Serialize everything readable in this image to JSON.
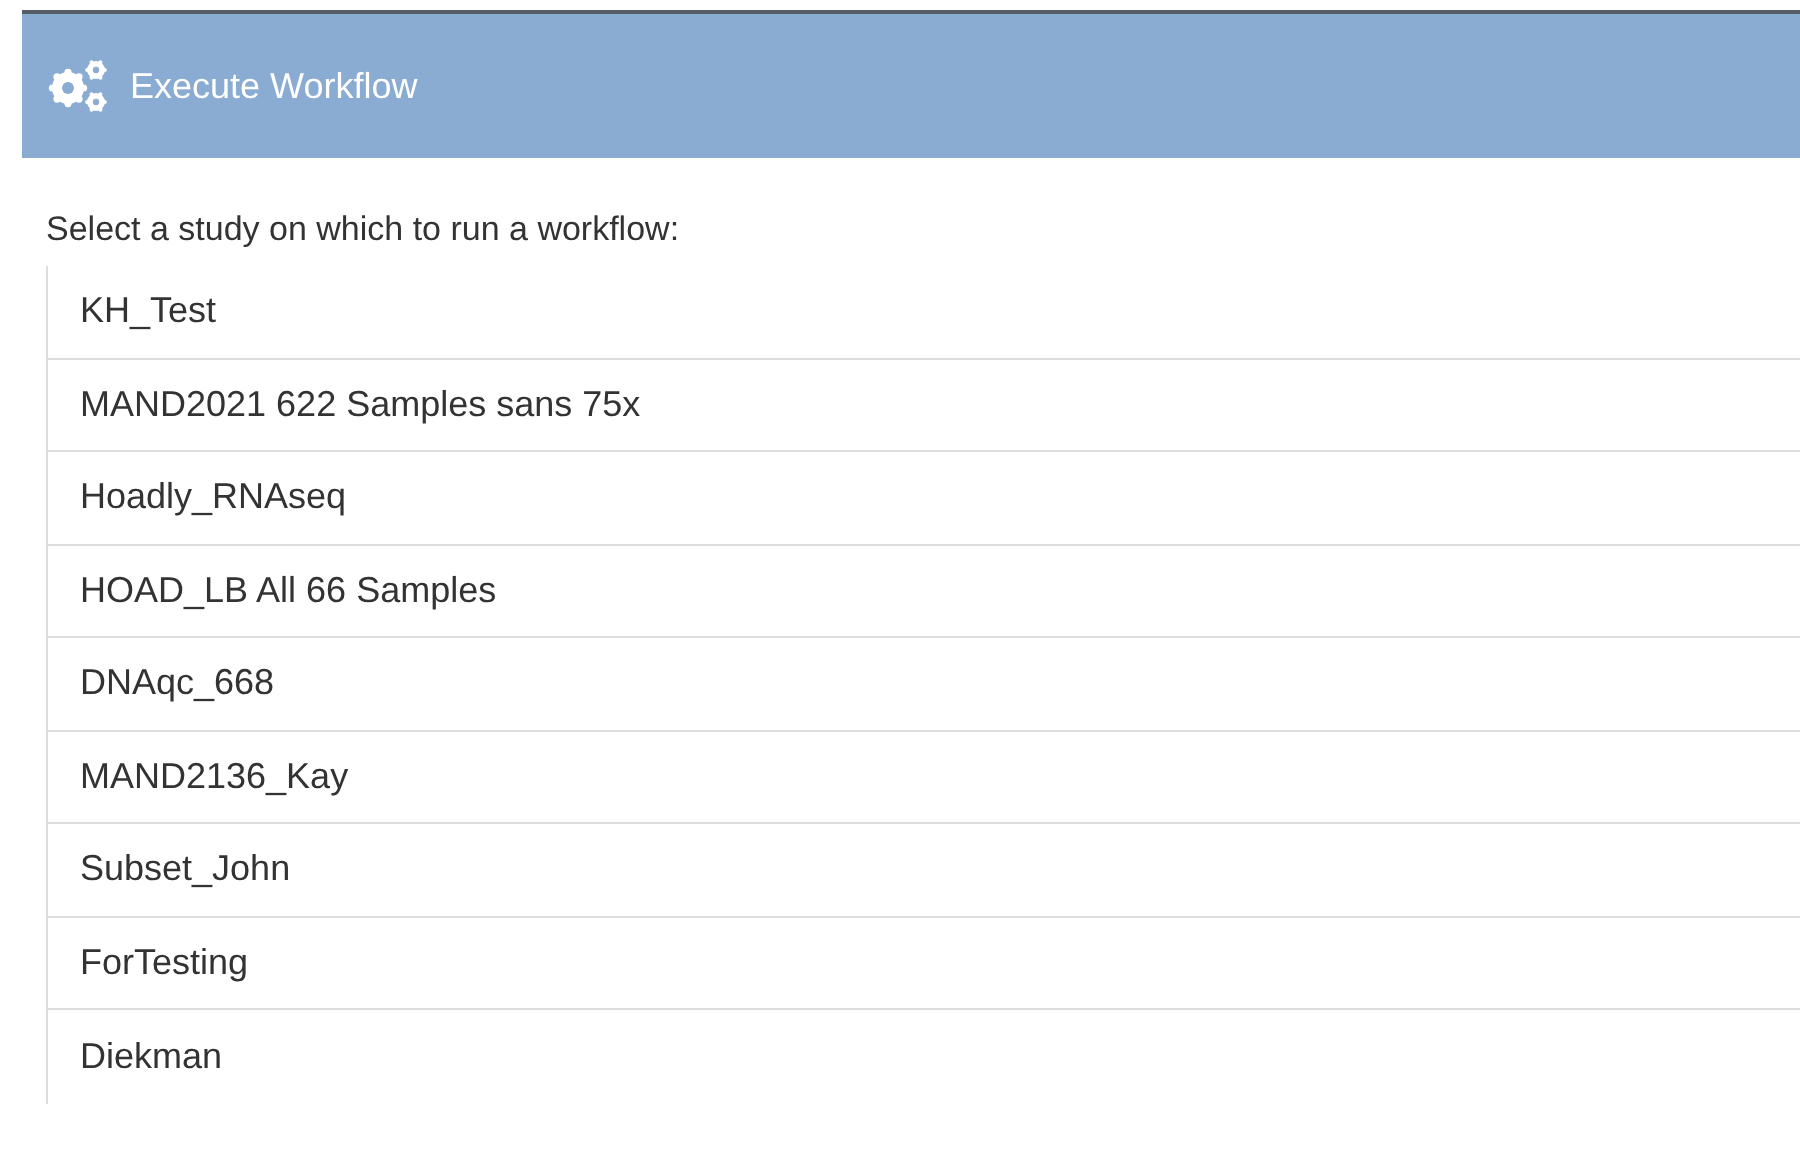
{
  "header": {
    "title": "Execute Workflow"
  },
  "prompt": "Select a study on which to run a workflow:",
  "studies": [
    "KH_Test",
    "MAND2021 622 Samples sans 75x",
    "Hoadly_RNAseq",
    "HOAD_LB All 66 Samples",
    "DNAqc_668",
    "MAND2136_Kay",
    "Subset_John",
    "ForTesting",
    "Diekman"
  ]
}
